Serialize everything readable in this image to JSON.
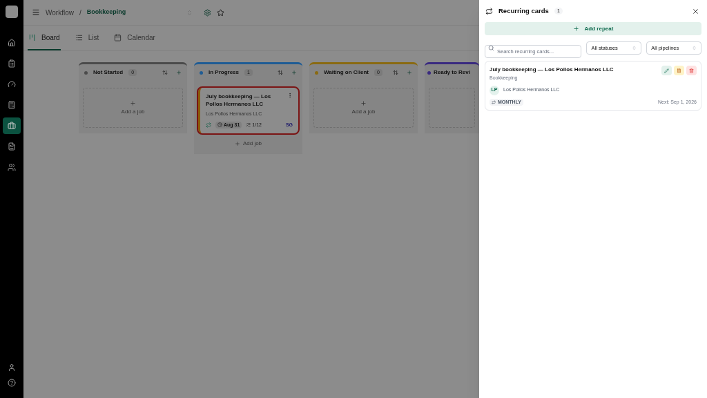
{
  "breadcrumb": {
    "root": "Workflow",
    "separator": "/",
    "current": "Bookkeeping"
  },
  "sidebar": {
    "items": [
      {
        "selected": false
      },
      {
        "selected": false
      },
      {
        "selected": false
      },
      {
        "selected": false
      },
      {
        "selected": true
      },
      {
        "selected": false
      },
      {
        "selected": false
      }
    ]
  },
  "tabs": [
    {
      "label": "Board",
      "selected": true
    },
    {
      "label": "List",
      "selected": false
    },
    {
      "label": "Calendar",
      "selected": false
    }
  ],
  "columns": [
    {
      "title": "Not Started",
      "count": "0",
      "color": "#4b4b4b",
      "add_label": "Add a job"
    },
    {
      "title": "In Progress",
      "count": "1",
      "color": "#1f5c94",
      "cards": [
        {
          "title": "July bookkeeping — Los Pollos Hermanos LLC",
          "client": "Los Pollos Hermanos LLC",
          "due": "Aug 31",
          "tasks": "1/12",
          "assignee": "SG",
          "recurring": true,
          "highlighted": true
        }
      ],
      "footer": "Add job"
    },
    {
      "title": "Waiting on Client",
      "count": "0",
      "color": "#8a6a12",
      "add_label": "Add a job"
    },
    {
      "title": "Ready to Revi",
      "color": "#3a2a80"
    }
  ],
  "panel": {
    "title": "Recurring cards",
    "count": "1",
    "add_button": "Add repeat",
    "search": {
      "placeholder": "Search recurring cards..."
    },
    "filters": [
      "All statuses",
      "All pipelines"
    ],
    "items": [
      {
        "title": "July bookkeeping — Los Pollos Hermanos LLC",
        "pipeline": "Bookkeeping",
        "client_initials": "LP",
        "client": "Los Pollos Hermanos LLC",
        "frequency": "MONTHLY",
        "next": "Next: Sep 1, 2026"
      }
    ]
  }
}
